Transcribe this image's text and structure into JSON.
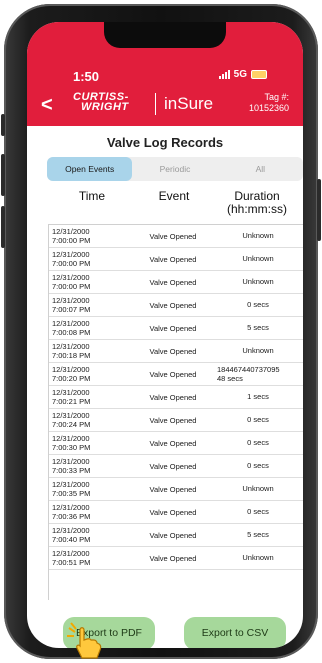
{
  "status": {
    "time": "1:50",
    "network": "5G"
  },
  "header": {
    "back_label": "<",
    "logo_line1": "CURTISS-",
    "logo_line2": "WRIGHT",
    "product": "inSure",
    "tag_label": "Tag #:",
    "tag_value": "10152360"
  },
  "page": {
    "title": "Valve Log Records"
  },
  "tabs": [
    {
      "label": "Open Events",
      "active": true
    },
    {
      "label": "Periodic",
      "active": false
    },
    {
      "label": "All",
      "active": false
    }
  ],
  "columns": {
    "time": "Time",
    "event": "Event",
    "duration_line1": "Duration",
    "duration_line2": "(hh:mm:ss)"
  },
  "rows": [
    {
      "date": "12/31/2000",
      "time": "7:00:00 PM",
      "event": "Valve Opened",
      "duration": "Unknown"
    },
    {
      "date": "12/31/2000",
      "time": "7:00:00 PM",
      "event": "Valve Opened",
      "duration": "Unknown"
    },
    {
      "date": "12/31/2000",
      "time": "7:00:00 PM",
      "event": "Valve Opened",
      "duration": "Unknown"
    },
    {
      "date": "12/31/2000",
      "time": "7:00:07 PM",
      "event": "Valve Opened",
      "duration": "0 secs"
    },
    {
      "date": "12/31/2000",
      "time": "7:00:08 PM",
      "event": "Valve Opened",
      "duration": "5 secs"
    },
    {
      "date": "12/31/2000",
      "time": "7:00:18 PM",
      "event": "Valve Opened",
      "duration": "Unknown"
    },
    {
      "date": "12/31/2000",
      "time": "7:00:20 PM",
      "event": "Valve Opened",
      "duration": "184467440737095",
      "duration2": "48 secs"
    },
    {
      "date": "12/31/2000",
      "time": "7:00:21 PM",
      "event": "Valve Opened",
      "duration": "1 secs"
    },
    {
      "date": "12/31/2000",
      "time": "7:00:24 PM",
      "event": "Valve Opened",
      "duration": "0 secs"
    },
    {
      "date": "12/31/2000",
      "time": "7:00:30 PM",
      "event": "Valve Opened",
      "duration": "0 secs"
    },
    {
      "date": "12/31/2000",
      "time": "7:00:33 PM",
      "event": "Valve Opened",
      "duration": "0 secs"
    },
    {
      "date": "12/31/2000",
      "time": "7:00:35 PM",
      "event": "Valve Opened",
      "duration": "Unknown"
    },
    {
      "date": "12/31/2000",
      "time": "7:00:36 PM",
      "event": "Valve Opened",
      "duration": "0 secs"
    },
    {
      "date": "12/31/2000",
      "time": "7:00:40 PM",
      "event": "Valve Opened",
      "duration": "5 secs"
    },
    {
      "date": "12/31/2000",
      "time": "7:00:51 PM",
      "event": "Valve Opened",
      "duration": "Unknown"
    }
  ],
  "buttons": {
    "export_pdf": "Export to PDF",
    "export_csv": "Export to CSV"
  },
  "colors": {
    "brand_red": "#e11e3c",
    "tab_active": "#a9d4ea",
    "button_green": "#a6d89b"
  }
}
